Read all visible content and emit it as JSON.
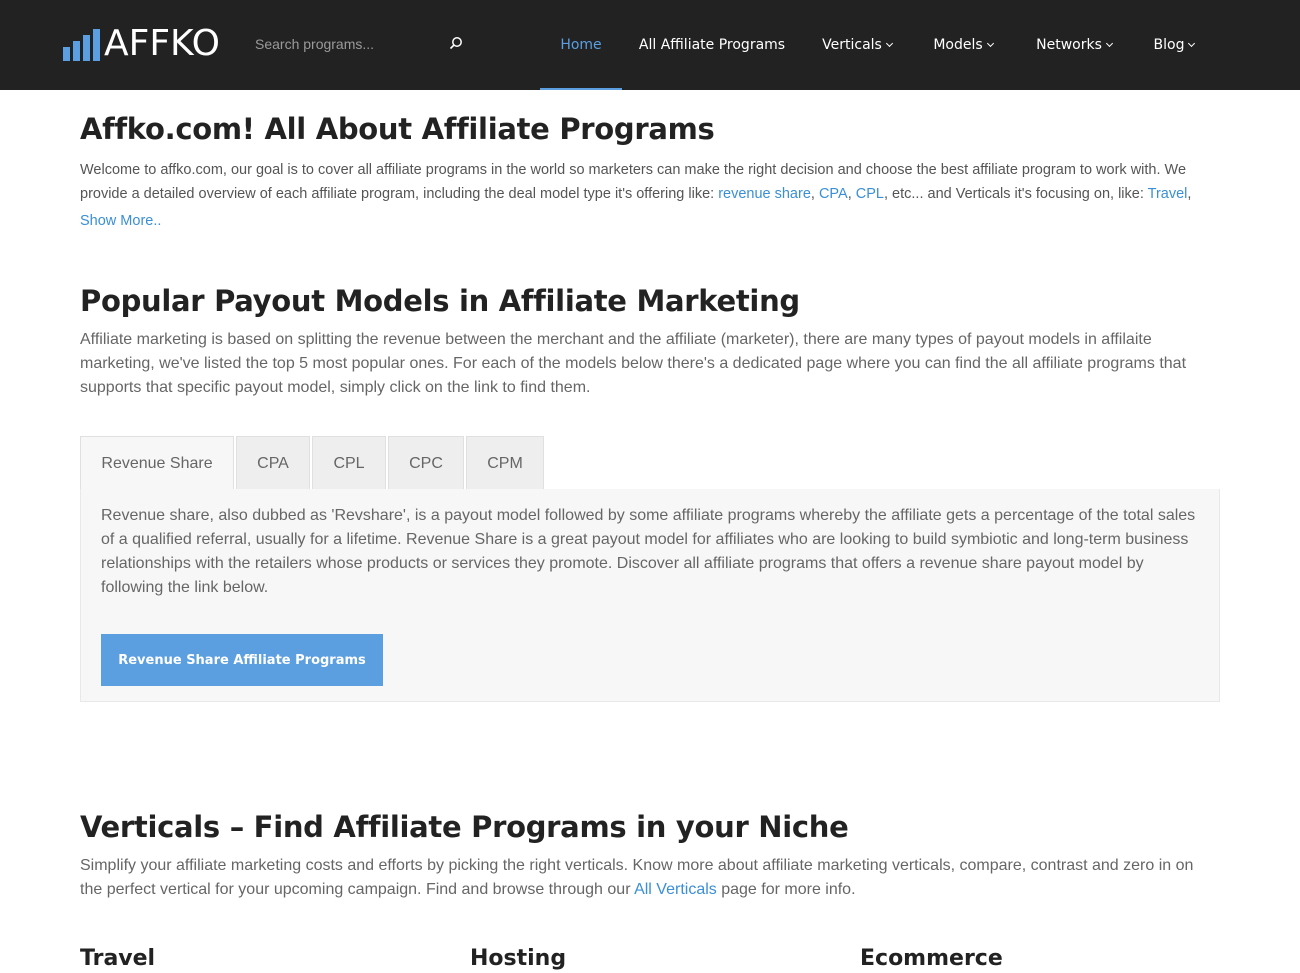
{
  "header": {
    "logo_text": "AFFKO",
    "search_placeholder": "Search programs...",
    "nav": [
      {
        "label": "Home",
        "active": true,
        "dropdown": false
      },
      {
        "label": "All Affiliate Programs",
        "active": false,
        "dropdown": false
      },
      {
        "label": "Verticals",
        "active": false,
        "dropdown": true
      },
      {
        "label": "Models",
        "active": false,
        "dropdown": true
      },
      {
        "label": "Networks",
        "active": false,
        "dropdown": true
      },
      {
        "label": "Blog",
        "active": false,
        "dropdown": true
      }
    ],
    "accent_color": "#5b9fe0",
    "bg_color": "#222222"
  },
  "intro": {
    "title": "Affko.com! All About Affiliate Programs",
    "text_1": "Welcome to affko.com, our goal is to cover all affiliate programs in the world so marketers can make the right decision and choose the best affiliate program to work with. We provide a detailed overview of each affiliate program, including the deal model type it's offering like: ",
    "link_revshare": "revenue share",
    "sep_1": ", ",
    "link_cpa": "CPA",
    "sep_2": ", ",
    "link_cpl": "CPL",
    "text_2": ", etc... and Verticals it's focusing on, like: ",
    "link_travel": "Travel",
    "text_3": ",",
    "show_more": "Show More.."
  },
  "payout": {
    "title": "Popular Payout Models in Affiliate Marketing",
    "text": "Affiliate marketing is based on splitting the revenue between the merchant and the affiliate (marketer), there are many types of payout models in affilaite marketing, we've listed the top 5 most popular ones. For each of the models below there's a dedicated page where you can find the all affiliate programs that supports that specific payout model, simply click on the link to find them.",
    "tabs": [
      {
        "label": "Revenue Share",
        "active": true
      },
      {
        "label": "CPA",
        "active": false
      },
      {
        "label": "CPL",
        "active": false
      },
      {
        "label": "CPC",
        "active": false
      },
      {
        "label": "CPM",
        "active": false
      }
    ],
    "panel_text": "Revenue share, also dubbed as 'Revshare', is a payout model followed by some affiliate programs whereby the affiliate gets a percentage of the total sales of a qualified referral, usually for a lifetime. Revenue Share is a great payout model for affiliates who are looking to build symbiotic and long-term business relationships with the retailers whose products or services they promote. Discover all affiliate programs that offers a revenue share payout model by following the link below.",
    "panel_button": "Revenue Share Affiliate Programs"
  },
  "verticals": {
    "title": "Verticals – Find Affiliate Programs in your Niche",
    "text_1": "Simplify your affiliate marketing costs and efforts by picking the right verticals. Know more about affiliate marketing verticals, compare, contrast and zero in on the perfect vertical for your upcoming campaign. Find and browse through our ",
    "link_all": "All Verticals",
    "text_2": " page for more info.",
    "columns": [
      "Travel",
      "Hosting",
      "Ecommerce"
    ]
  }
}
